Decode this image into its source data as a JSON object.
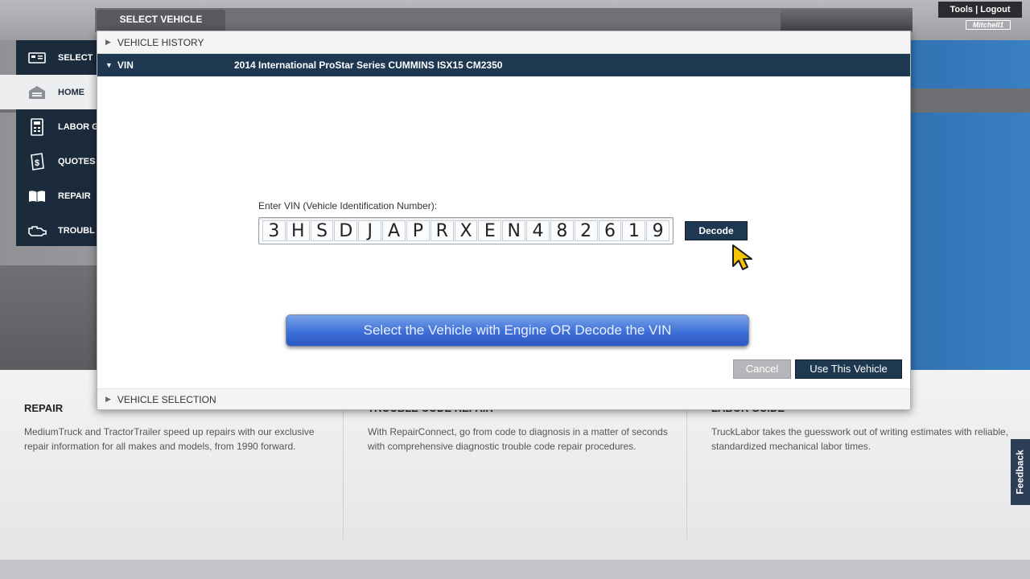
{
  "header": {
    "tools_logout": "Tools | Logout",
    "logo_text": "Mitchell1"
  },
  "nav": {
    "items": [
      {
        "label": "SELECT",
        "icon": "car-icon"
      },
      {
        "label": "HOME",
        "icon": "garage-icon"
      },
      {
        "label": "LABOR G",
        "icon": "calculator-icon"
      },
      {
        "label": "QUOTES",
        "icon": "quote-icon"
      },
      {
        "label": "REPAIR",
        "icon": "book-icon"
      },
      {
        "label": "TROUBL",
        "icon": "engine-icon"
      }
    ]
  },
  "modal": {
    "tab_title": "SELECT VEHICLE",
    "vehicle_history": "VEHICLE HISTORY",
    "vin_section": "VIN",
    "vehicle_name": "2014 International ProStar Series CUMMINS ISX15 CM2350",
    "vin_label": "Enter VIN (Vehicle Identification Number):",
    "vin_chars": [
      "3",
      "H",
      "S",
      "D",
      "J",
      "A",
      "P",
      "R",
      "X",
      "E",
      "N",
      "4",
      "8",
      "2",
      "6",
      "1",
      "9"
    ],
    "decode_label": "Decode",
    "banner": "Select the Vehicle with Engine OR Decode the VIN",
    "cancel_label": "Cancel",
    "use_vehicle_label": "Use This Vehicle",
    "vehicle_selection": "VEHICLE SELECTION"
  },
  "sections": [
    {
      "title": "REPAIR",
      "text": "MediumTruck and TractorTrailer speed up repairs with our exclusive repair information for all makes and models, from 1990 forward."
    },
    {
      "title": "TROUBLE CODE REPAIR",
      "text": "With RepairConnect, go from code to diagnosis in a matter of seconds with comprehensive diagnostic trouble code repair procedures."
    },
    {
      "title": "LABOR GUIDE",
      "text": "TruckLabor takes the guesswork out of writing estimates with reliable, standardized mechanical labor times."
    }
  ],
  "feedback": "Feedback",
  "colors": {
    "navy": "#1f3852",
    "banner_blue": "#3d6fd8",
    "cursor_yellow": "#f5c400"
  }
}
